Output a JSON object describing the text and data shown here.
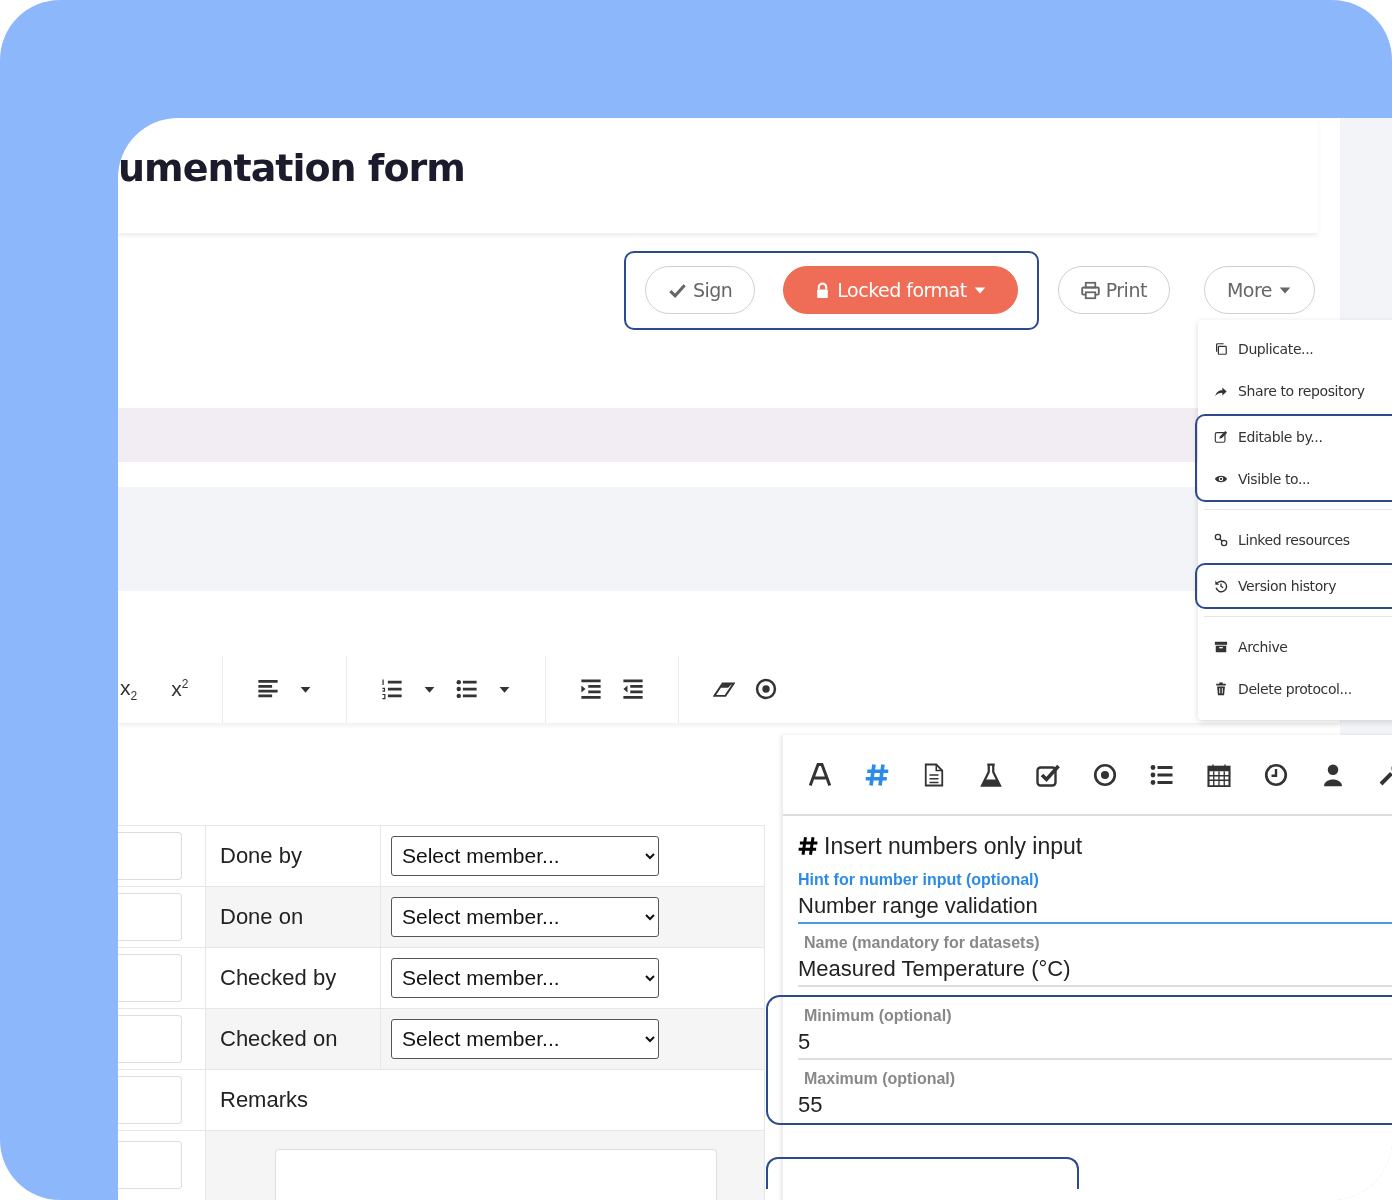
{
  "title": "umentation form",
  "action_groups": [
    {
      "highlighted": true,
      "buttons": [
        {
          "label": "Sign",
          "kind": "check",
          "caret": false
        },
        {
          "label": "Locked format",
          "kind": "lock",
          "caret": true
        }
      ]
    },
    {
      "highlighted": false,
      "buttons": [
        {
          "label": "Print",
          "kind": "print",
          "caret": false
        },
        {
          "label": "More",
          "kind": "none",
          "caret": true,
          "expanded": true
        }
      ]
    }
  ],
  "more_menu": [
    [
      {
        "highlighted": false,
        "items": [
          {
            "label": "Duplicate...",
            "kind": "copy"
          },
          {
            "label": "Share to repository",
            "kind": "share"
          }
        ]
      },
      {
        "highlighted": true,
        "items": [
          {
            "label": "Editable by...",
            "kind": "edit"
          },
          {
            "label": "Visible to...",
            "kind": "eye"
          }
        ]
      }
    ],
    [
      {
        "highlighted": false,
        "items": [
          {
            "label": "Linked resources",
            "kind": "link"
          }
        ]
      },
      {
        "highlighted": true,
        "items": [
          {
            "label": "Version history",
            "kind": "history"
          }
        ]
      }
    ],
    [
      {
        "highlighted": false,
        "items": [
          {
            "label": "Archive",
            "kind": "archive"
          },
          {
            "label": "Delete protocol...",
            "kind": "trash"
          }
        ]
      }
    ]
  ],
  "editor_toolbar": [
    [
      {
        "kind": "text",
        "label": "x$_{2}$"
      },
      {
        "kind": "text",
        "label": "x$^{2}$"
      }
    ],
    [
      {
        "kind": "align",
        "caret": true
      }
    ],
    [
      {
        "kind": "ordered-list",
        "caret": true
      },
      {
        "kind": "bullet-list",
        "caret": true
      }
    ],
    [
      {
        "kind": "indent",
        "caret": false
      },
      {
        "kind": "outdent",
        "caret": false
      }
    ],
    [
      {
        "kind": "eraser",
        "caret": false
      },
      {
        "kind": "radio",
        "caret": false
      }
    ]
  ],
  "table": {
    "rows": [
      {
        "kind": "select",
        "label": "Done by",
        "value": "Select member..."
      },
      {
        "kind": "select",
        "label": "Done on",
        "value": "Select member..."
      },
      {
        "kind": "select",
        "label": "Checked by",
        "value": "Select member..."
      },
      {
        "kind": "select",
        "label": "Checked on",
        "value": "Select member..."
      },
      {
        "kind": "text",
        "label": "Remarks"
      },
      {
        "kind": "textarea"
      }
    ]
  },
  "field_panel": {
    "input_types": [
      {
        "kind": "font",
        "selected": false
      },
      {
        "kind": "hash",
        "selected": true
      },
      {
        "kind": "file",
        "selected": false
      },
      {
        "kind": "flask",
        "selected": false
      },
      {
        "kind": "checkbox",
        "selected": false
      },
      {
        "kind": "radio",
        "selected": false
      },
      {
        "kind": "list",
        "selected": false
      },
      {
        "kind": "calendar",
        "selected": false
      },
      {
        "kind": "clock",
        "selected": false
      },
      {
        "kind": "user",
        "selected": false
      },
      {
        "kind": "wrench",
        "selected": false
      }
    ],
    "heading": "Insert numbers only input",
    "field_groups": [
      {
        "highlighted": false,
        "fields": [
          {
            "label": "Hint for number input (optional)",
            "value": "Number range validation",
            "focused": true
          },
          {
            "label": "Name (mandatory for datasets)",
            "value": "Measured Temperature (°C)",
            "focused": false
          }
        ]
      },
      {
        "highlighted": true,
        "fields": [
          {
            "label": "Minimum (optional)",
            "value": "5",
            "focused": false
          },
          {
            "label": "Maximum (optional)",
            "value": "55",
            "focused": false
          }
        ]
      }
    ]
  }
}
